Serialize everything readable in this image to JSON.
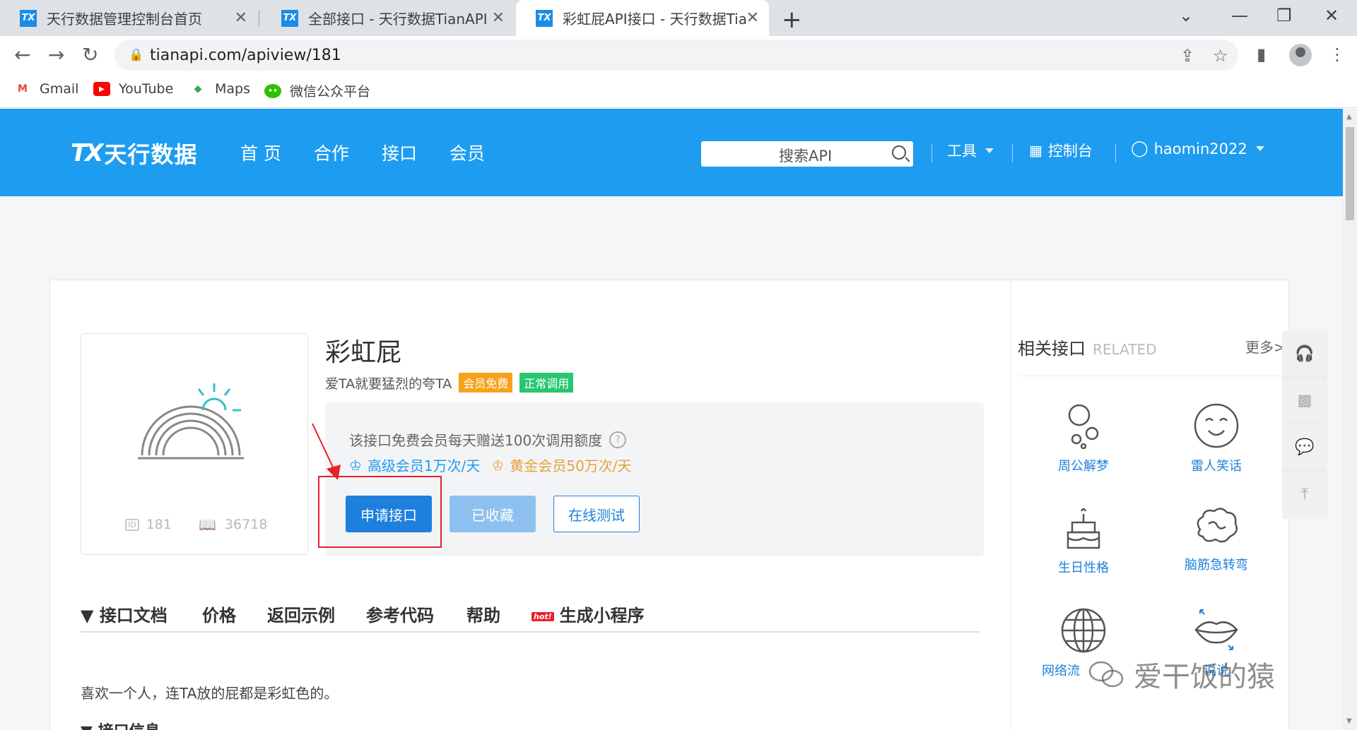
{
  "browser": {
    "tabs": [
      {
        "title": "天行数据管理控制台首页"
      },
      {
        "title": "全部接口 - 天行数据TianAPI"
      },
      {
        "title": "彩虹屁API接口 - 天行数据TianAPI"
      }
    ],
    "url": "tianapi.com/apiview/181",
    "bookmarks": [
      {
        "label": "Gmail",
        "icon": "gmail-icon"
      },
      {
        "label": "YouTube",
        "icon": "youtube-icon"
      },
      {
        "label": "Maps",
        "icon": "maps-icon"
      },
      {
        "label": "微信公众平台",
        "icon": "wechat-icon"
      }
    ]
  },
  "site": {
    "logo_mark": "TX",
    "logo_text": "天行数据",
    "nav": [
      "首 页",
      "合作",
      "接口",
      "会员"
    ],
    "search_placeholder": "搜索API",
    "tools": "工具",
    "console": "控制台",
    "username": "haomin2022",
    "brand_color": "#1e9cf0"
  },
  "api": {
    "id": "181",
    "views": "36718",
    "title": "彩虹屁",
    "subtitle": "爱TA就要猛烈的夸TA",
    "badge_free": "会员免费",
    "badge_status": "正常调用",
    "quota_note": "该接口免费会员每天赠送100次调用额度",
    "tier_senior": "高级会员1万次/天",
    "tier_gold": "黄金会员50万次/天",
    "btn_apply": "申请接口",
    "btn_fav": "已收藏",
    "btn_test": "在线测试"
  },
  "doc": {
    "tabs": [
      "▼ 接口文档",
      "价格",
      "返回示例",
      "参考代码",
      "帮助",
      "生成小程序"
    ],
    "hot_label": "hot!",
    "description": "喜欢一个人，连TA放的屁都是彩虹色的。",
    "next_section": "▼ 接口信息"
  },
  "related": {
    "heading": "相关接口",
    "heading_en": "RELATED",
    "more": "更多>",
    "items": [
      {
        "label": "周公解梦",
        "icon": "bubbles-icon"
      },
      {
        "label": "雷人笑话",
        "icon": "smiley-icon"
      },
      {
        "label": "生日性格",
        "icon": "cake-icon"
      },
      {
        "label": "脑筋急转弯",
        "icon": "brain-icon"
      },
      {
        "label": "网络流",
        "icon": "globe-icon"
      },
      {
        "label": "说说",
        "icon": "lips-icon"
      }
    ]
  },
  "watermark": "爱干饭的猿"
}
